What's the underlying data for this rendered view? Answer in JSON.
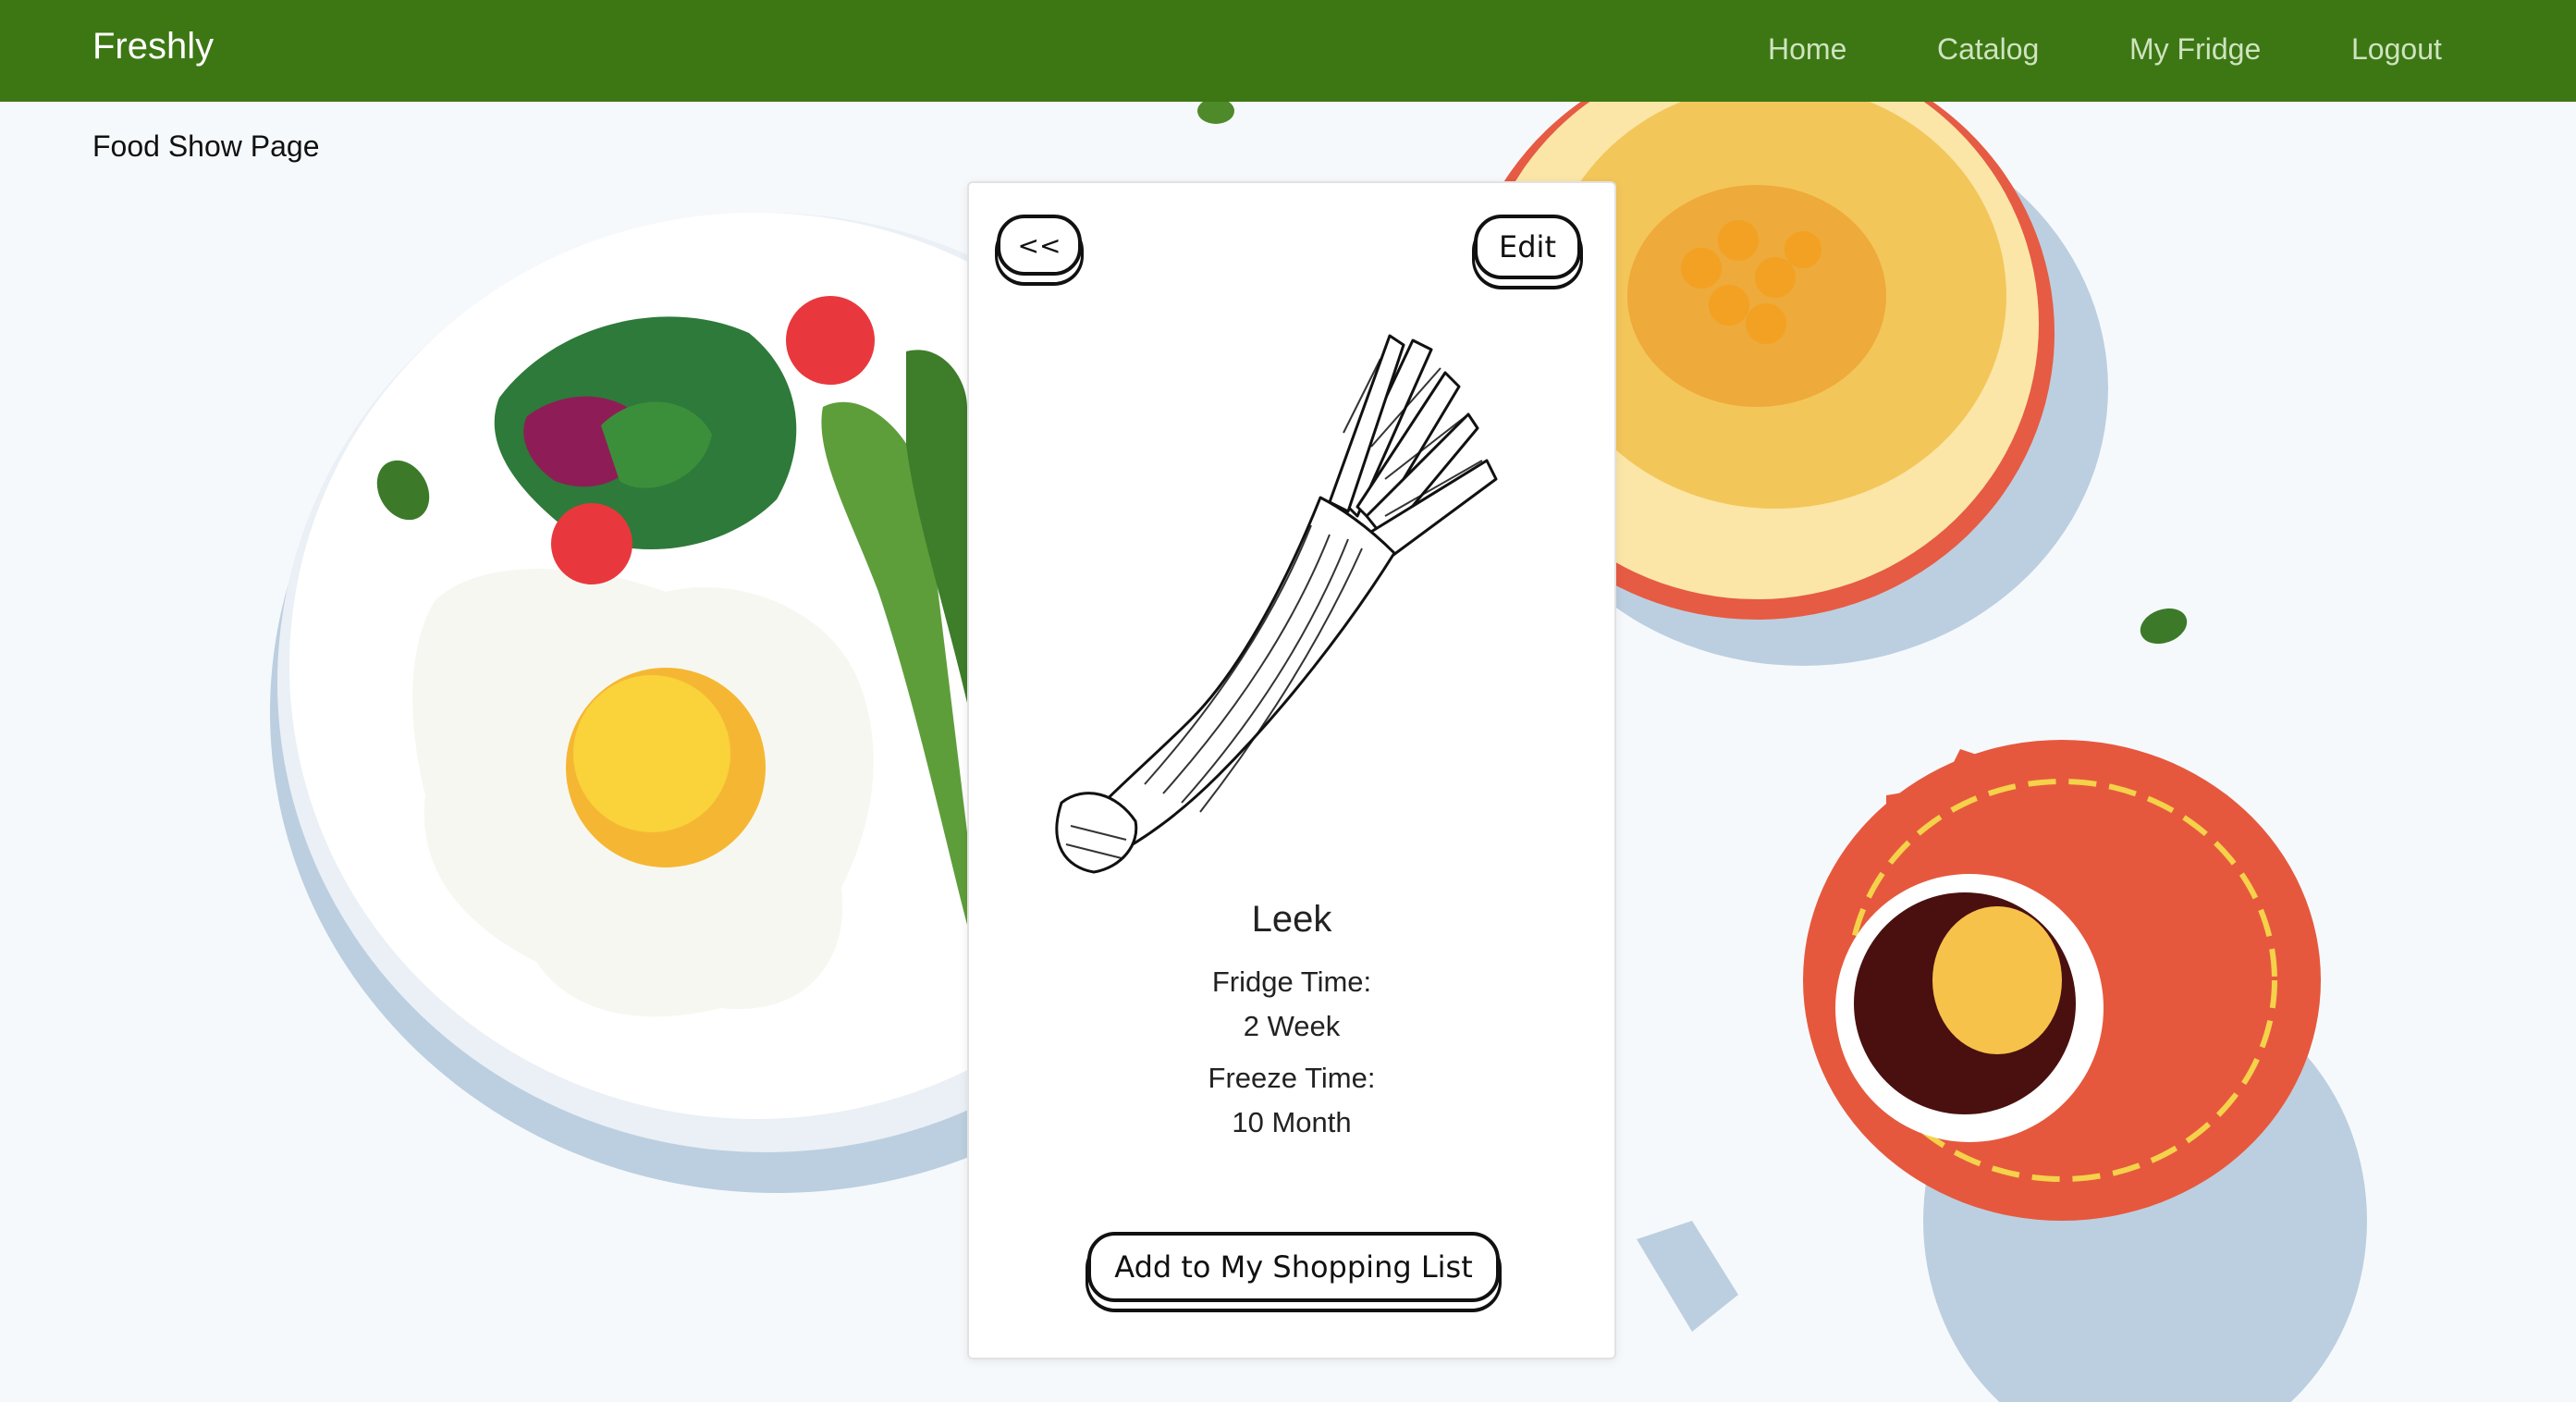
{
  "nav": {
    "brand": "Freshly",
    "links": [
      "Home",
      "Catalog",
      "My Fridge",
      "Logout"
    ]
  },
  "page_label": "Food Show Page",
  "card": {
    "back_label": "<<",
    "edit_label": "Edit",
    "food_name": "Leek",
    "fridge_time_label": "Fridge Time:",
    "fridge_time_value": "2 Week",
    "freeze_time_label": "Freeze Time:",
    "freeze_time_value": "10 Month",
    "add_label": "Add to My Shopping List"
  },
  "colors": {
    "navbar": "#3c7713",
    "nav_link": "#cfe3c0",
    "page_bg": "#f6f9fc"
  },
  "icons": {
    "leek_illustration": "leek-icon"
  }
}
